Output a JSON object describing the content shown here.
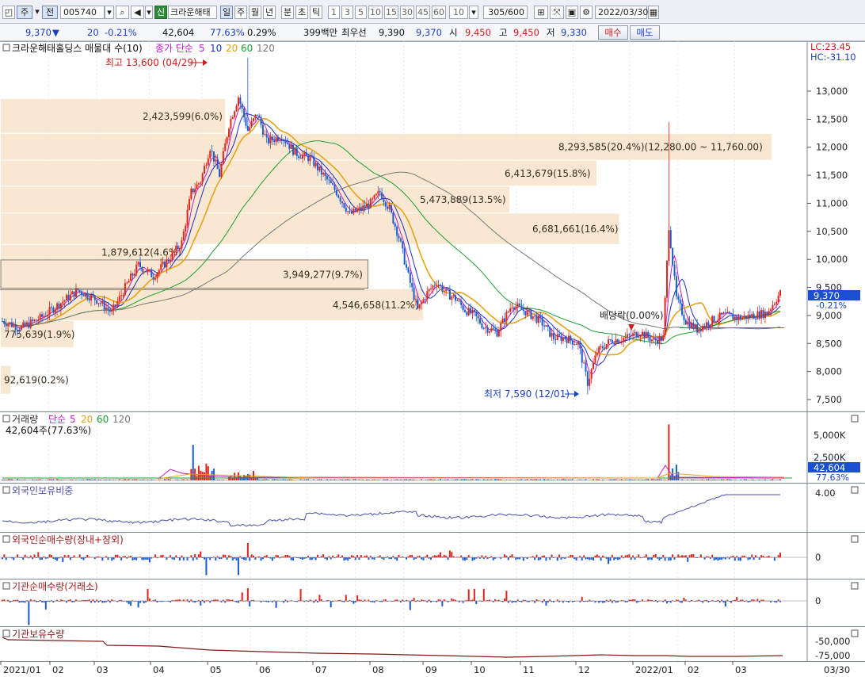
{
  "toolbar": {
    "market": "주",
    "range": "전",
    "code": "005740",
    "badge": "신",
    "name": "크라운해태",
    "periods": [
      "일",
      "주",
      "월",
      "년",
      "분",
      "초",
      "틱"
    ],
    "minutes": [
      "1",
      "3",
      "5",
      "10",
      "15",
      "30",
      "45",
      "60"
    ],
    "interval": "10",
    "count": "305/600",
    "date": "2022/03/30"
  },
  "quote": {
    "price": "9,370",
    "change": "20",
    "change_pct": "-0.21%",
    "volume": "42,604",
    "volume_ratio": "77.63%",
    "turnover": "0.29%",
    "amount": "399백만",
    "best_ask_label": "최우선",
    "best_ask": "9,390",
    "best_bid": "9,370",
    "open_label": "시",
    "open": "9,450",
    "high_label": "고",
    "high": "9,450",
    "low_label": "저",
    "low": "9,330",
    "buy": "매수",
    "sell": "매도"
  },
  "main_panel": {
    "legend_title": "크라운해태홀딩스 매물대 수(10)",
    "ma_label": "종가 단순",
    "ma_periods": [
      "5",
      "10",
      "20",
      "60",
      "120"
    ],
    "ma_colors": [
      "#c21ec8",
      "#1b2fbf",
      "#e8a317",
      "#1e9e2f",
      "#777777"
    ],
    "lc": "LC:23.45",
    "hc": "HC:-31.10",
    "y_ticks": [
      "13,000",
      "12,500",
      "12,000",
      "11,500",
      "11,000",
      "10,500",
      "10,000",
      "9,500",
      "9,000",
      "8,500",
      "8,000",
      "7,500"
    ],
    "price_badge": "9,370",
    "price_badge_pct": "-0.21%",
    "high_annot": "최고 13,600 (04/29)",
    "low_annot": "최저 7,590 (12/01)",
    "dividend_annot": "배당락(0.00%)",
    "volume_profile": [
      "8,293,585(20.4%)(12,280.00 ~ 11,760.00)",
      "6,413,679(15.8%)",
      "5,473,889(13.5%)",
      "6,681,661(16.4%)",
      "3,949,277(9.7%)",
      "4,546,658(11.2%)",
      "775,639(1.9%)",
      "92,619(0.2%)",
      "2,423,599(6.0%)",
      "1,879,612(4.6%)"
    ]
  },
  "volume_panel": {
    "title": "거래량",
    "ma_label": "단순",
    "ma_periods": [
      "5",
      "20",
      "60",
      "120"
    ],
    "value": "42,604주(77.63%)",
    "ticks": [
      "5,000K",
      "2,500K"
    ],
    "badge": "42,604",
    "badge_pct": "77.63%"
  },
  "foreign_ratio_panel": {
    "title": "외국인보유비중",
    "tick": "4.00"
  },
  "foreign_net_panel": {
    "title": "외국인순매수량(장내+장외)",
    "tick": "0"
  },
  "inst_net_panel": {
    "title": "기관순매수량(거래소)",
    "tick": "0"
  },
  "inst_hold_panel": {
    "title": "기관보유수량",
    "ticks": [
      "-50,000",
      "-75,000"
    ]
  },
  "x_axis": [
    "2021/01",
    "02",
    "03",
    "04",
    "05",
    "06",
    "07",
    "08",
    "09",
    "10",
    "11",
    "12",
    "2022/01",
    "02",
    "03",
    "03/30"
  ],
  "colors": {
    "up": "#e0241c",
    "down": "#1b5bd1",
    "profile": "#f8e8d2",
    "price_badge": "#1a4fd0"
  }
}
